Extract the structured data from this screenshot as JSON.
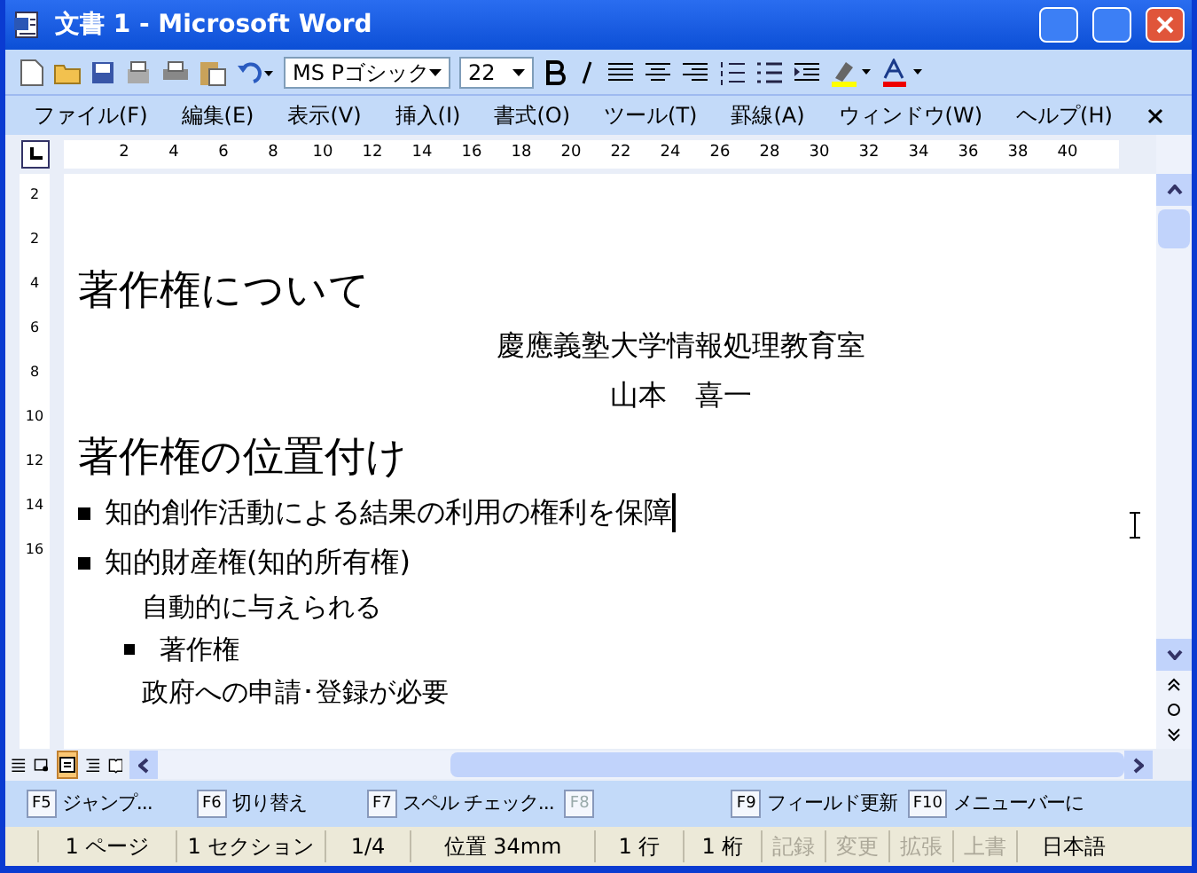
{
  "window": {
    "title": "文書 1 - Microsoft Word"
  },
  "toolbar": {
    "font_name": "MS Pゴシック",
    "font_size": "22"
  },
  "menu": [
    "ファイル(F)",
    "編集(E)",
    "表示(V)",
    "挿入(I)",
    "書式(O)",
    "ツール(T)",
    "罫線(A)",
    "ウィンドウ(W)",
    "ヘルプ(H)"
  ],
  "ruler": {
    "ticks": [
      "2",
      "4",
      "6",
      "8",
      "10",
      "12",
      "14",
      "16",
      "18",
      "20",
      "22",
      "24",
      "26",
      "28",
      "30",
      "32",
      "34",
      "36",
      "38",
      "40"
    ],
    "vertical_ticks": [
      "2",
      "2",
      "4",
      "6",
      "8",
      "10",
      "12",
      "14",
      "16"
    ]
  },
  "document": [
    {
      "kind": "heading",
      "text": "著作権について"
    },
    {
      "kind": "center",
      "text": "慶應義塾大学情報処理教育室"
    },
    {
      "kind": "center",
      "text": "山本　喜一"
    },
    {
      "kind": "heading",
      "text": "著作権の位置付け"
    },
    {
      "kind": "bullet",
      "text": "知的創作活動による結果の利用の権利を保障",
      "cursor": true
    },
    {
      "kind": "bullet",
      "text": "知的財産権(知的所有権)"
    },
    {
      "kind": "indent",
      "text": "自動的に与えられる "
    },
    {
      "kind": "subbullet",
      "text": "著作権 "
    },
    {
      "kind": "indent",
      "text": "政府への申請･登録が必要 "
    }
  ],
  "function_keys": [
    {
      "key": "F5",
      "label": "ジャンプ...",
      "disabled": false
    },
    {
      "key": "F6",
      "label": "切り替え",
      "disabled": false
    },
    {
      "key": "F7",
      "label": "スペル チェック...",
      "disabled": false
    },
    {
      "key": "F8",
      "disabled": true
    },
    {
      "key": "F9",
      "label": "フィールド更新",
      "disabled": false
    },
    {
      "key": "F10",
      "label": "メニューバーに",
      "disabled": false
    }
  ],
  "status_bar": [
    {
      "text": "1 ページ",
      "disabled": false
    },
    {
      "text": "1 セクション",
      "disabled": false
    },
    {
      "text": "1/4",
      "disabled": false
    },
    {
      "text": "位置 34mm",
      "disabled": false
    },
    {
      "text": "1 行",
      "disabled": false
    },
    {
      "text": "1 桁",
      "disabled": false
    },
    {
      "text": "記録",
      "disabled": true
    },
    {
      "text": "変更",
      "disabled": true
    },
    {
      "text": "拡張",
      "disabled": true
    },
    {
      "text": "上書",
      "disabled": true
    },
    {
      "text": "日本語",
      "disabled": false
    }
  ]
}
